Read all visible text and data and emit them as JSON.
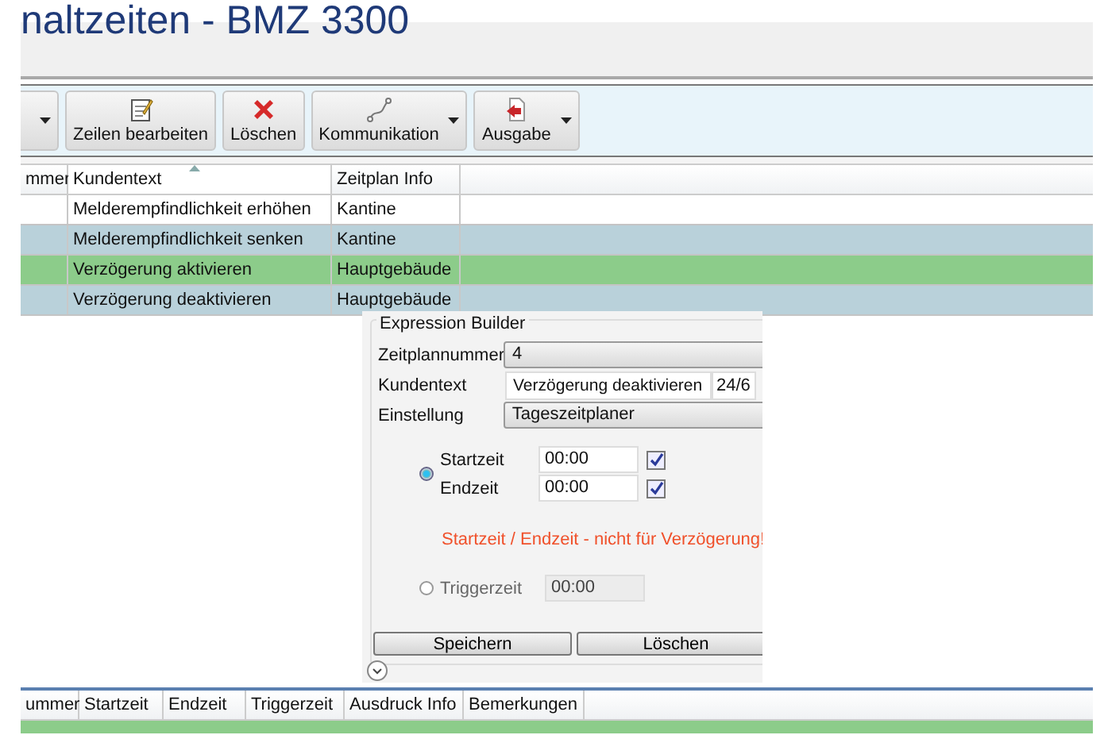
{
  "title": "naltzeiten - BMZ 3300",
  "toolbar": [
    {
      "kind": "partial",
      "menu": true
    },
    {
      "kind": "edit",
      "label": "Zeilen bearbeiten",
      "menu": false
    },
    {
      "kind": "delete",
      "label": "Löschen",
      "menu": false
    },
    {
      "kind": "link",
      "label": "Kommunikation",
      "menu": true
    },
    {
      "kind": "output",
      "label": "Ausgabe",
      "menu": true
    }
  ],
  "grid": {
    "columns": [
      "mmer",
      "Kundentext",
      "Zeitplan Info"
    ],
    "rows": [
      {
        "color": "#ffffff",
        "kundentext": "Melderempfindlichkeit erhöhen",
        "zeitplan_info": "Kantine"
      },
      {
        "color": "#b9d1da",
        "kundentext": "Melderempfindlichkeit senken",
        "zeitplan_info": "Kantine"
      },
      {
        "color": "#8ccc8a",
        "kundentext": "Verzögerung aktivieren",
        "zeitplan_info": "Hauptgebäude"
      },
      {
        "color": "#b9d1da",
        "kundentext": "Verzögerung deaktivieren",
        "zeitplan_info": "Hauptgebäude"
      }
    ]
  },
  "expression_builder": {
    "title": "Expression Builder",
    "zeitplannummer": {
      "label": "Zeitplannummer",
      "value": "4"
    },
    "kundentext": {
      "label": "Kundentext",
      "value": "Verzögerung deaktivieren",
      "suffix": "24/6"
    },
    "einstellung": {
      "label": "Einstellung",
      "value": "Tageszeitplaner"
    },
    "range_selected": true,
    "times": [
      {
        "label": "Startzeit",
        "value": "00:00",
        "checked": true
      },
      {
        "label": "Endzeit",
        "value": "00:00",
        "checked": true
      }
    ],
    "warning": "Startzeit / Endzeit - nicht für Verzögerung!",
    "trigger": {
      "label": "Triggerzeit",
      "value": "00:00",
      "selected": false,
      "disabled": true
    },
    "buttons": [
      "Speichern",
      "Löschen"
    ]
  },
  "lower_grid": {
    "columns": [
      "ummer",
      "Startzeit",
      "Endzeit",
      "Triggerzeit",
      "Ausdruck Info",
      "Bemerkungen"
    ]
  }
}
